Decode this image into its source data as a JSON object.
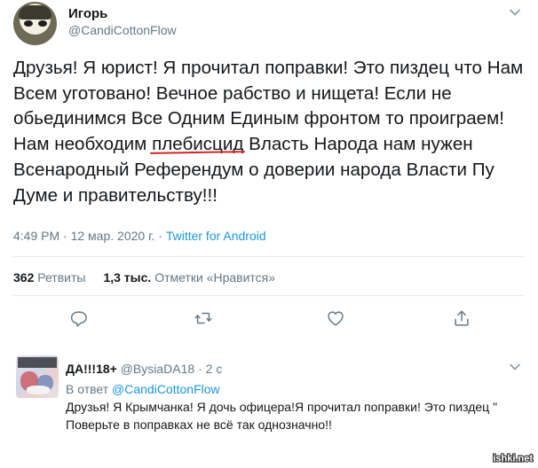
{
  "tweet": {
    "author_name": "Игорь",
    "author_handle": "@CandiCottonFlow",
    "text_before": "Друзья! Я юрист! Я прочитал поправки! Это пиздец что Нам Всем уготовано! Вечное рабство и нищета! Если не обьединимся Все Одним Единым фронтом то проиграем! Нам необходим ",
    "text_underlined": "плебисцид",
    "text_after": " Власть Народа нам нужен Всенародный Референдум о доверии народа Власти Пу Думе и правительству!!!",
    "time": "4:49 PM",
    "date": "12 мар. 2020 г.",
    "separator": " · ",
    "source": "Twitter for Android",
    "retweets_count": "362",
    "retweets_label": "Ретвиты",
    "likes_count": "1,3 тыс.",
    "likes_label": "Отметки «Нравится»",
    "underline_color": "#d0262b",
    "link_color": "#1b95e0"
  },
  "actions": {
    "icons": [
      "reply-icon",
      "retweet-icon",
      "like-icon",
      "share-icon"
    ]
  },
  "reply": {
    "author_name": "ДА!!!18+",
    "author_handle": "@BysiaDA18",
    "time": "2 с",
    "separator": " · ",
    "reply_to_label": "В ответ",
    "reply_to_handle": "@CandiCottonFlow",
    "text": "Друзья! Я Крымчанка! Я дочь офицера!Я прочитал поправки! Это пиздец \" Поверьте в поправках не всё так однозначно!!"
  },
  "watermark": {
    "text": "Fishki.net"
  }
}
